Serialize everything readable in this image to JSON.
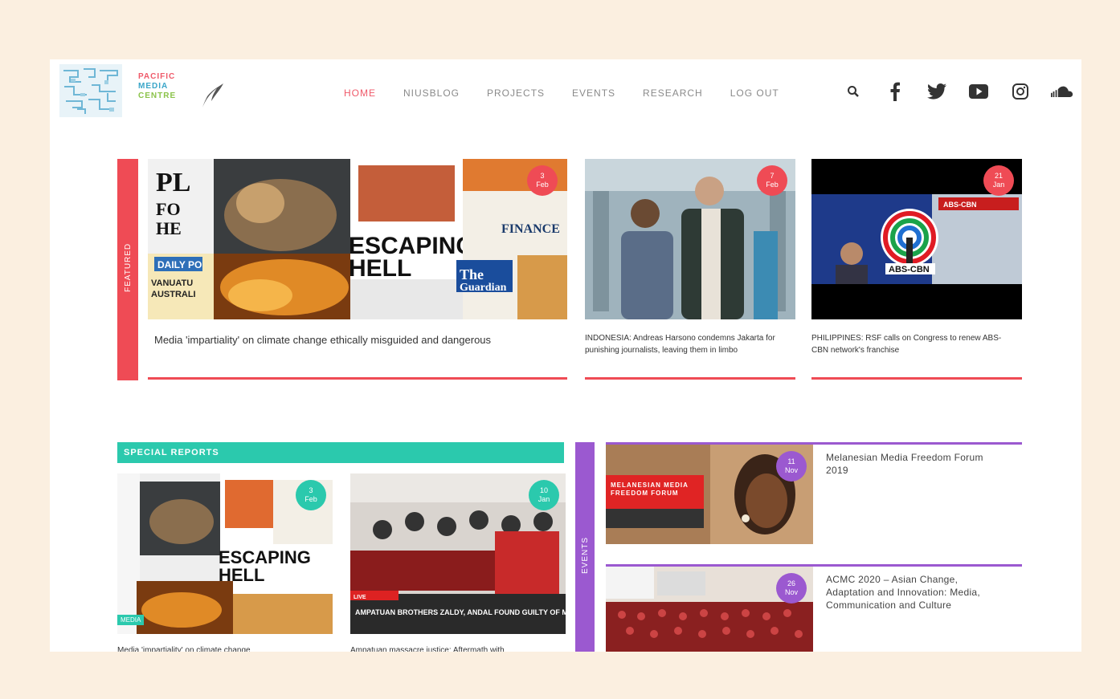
{
  "logo": {
    "line1": "PACIFIC",
    "line2": "MEDIA",
    "line3": "CENTRE",
    "colors": [
      "#ef5a6a",
      "#3aa6c9",
      "#8bc34a"
    ]
  },
  "nav": {
    "items": [
      {
        "label": "HOME",
        "active": true
      },
      {
        "label": "NIUSBLOG",
        "active": false
      },
      {
        "label": "PROJECTS",
        "active": false
      },
      {
        "label": "EVENTS",
        "active": false
      },
      {
        "label": "RESEARCH",
        "active": false
      },
      {
        "label": "LOG OUT",
        "active": false
      }
    ]
  },
  "social": [
    "search-icon",
    "facebook-icon",
    "twitter-icon",
    "youtube-icon",
    "instagram-icon",
    "soundcloud-icon"
  ],
  "featured": {
    "label": "FEATURED",
    "cards": [
      {
        "day": "3",
        "month": "Feb",
        "caption": "Media 'impartiality' on climate change ethically misguided and dangerous"
      },
      {
        "day": "7",
        "month": "Feb",
        "caption": "INDONESIA: Andreas Harsono condemns Jakarta for punishing journalists, leaving them in limbo"
      },
      {
        "day": "21",
        "month": "Jan",
        "caption": "PHILIPPINES: RSF calls on Congress to renew ABS-CBN network's franchise"
      }
    ]
  },
  "special_reports": {
    "label": "SPECIAL REPORTS",
    "cards": [
      {
        "day": "3",
        "month": "Feb",
        "tag": "MEDIA",
        "caption": "Media 'impartiality' on climate change"
      },
      {
        "day": "10",
        "month": "Jan",
        "caption": "Ampatuan massacre justice: Aftermath with"
      }
    ]
  },
  "events": {
    "label": "EVENTS",
    "items": [
      {
        "day": "11",
        "month": "Nov",
        "title": "Melanesian Media Freedom Forum 2019",
        "image_text": "MELANESIAN MEDIA FREEDOM FORUM"
      },
      {
        "day": "26",
        "month": "Nov",
        "title": "ACMC 2020 – Asian Change, Adaptation and Innovation: Media, Communication and Culture"
      }
    ]
  },
  "colors": {
    "accent_red": "#ef4b55",
    "accent_teal": "#2bc9ad",
    "accent_purple": "#9b59d0",
    "background": "#fbefe0"
  }
}
